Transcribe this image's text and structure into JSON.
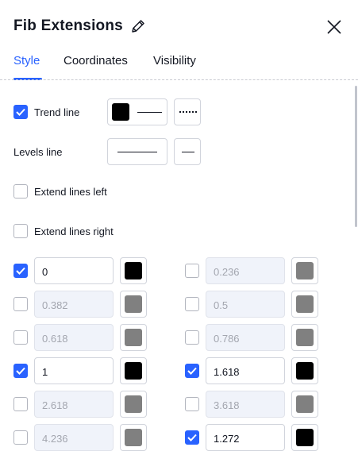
{
  "dialog": {
    "title": "Fib Extensions",
    "tabs": [
      {
        "label": "Style",
        "active": true
      },
      {
        "label": "Coordinates",
        "active": false
      },
      {
        "label": "Visibility",
        "active": false
      }
    ]
  },
  "style": {
    "trend_line": {
      "label": "Trend line",
      "checked": true,
      "color": "#000000",
      "line_style": "solid",
      "line_dash": "dotted"
    },
    "levels_line": {
      "label": "Levels line",
      "line_style": "solid"
    },
    "extend_left": {
      "label": "Extend lines left",
      "checked": false
    },
    "extend_right": {
      "label": "Extend lines right",
      "checked": false
    }
  },
  "levels": [
    {
      "value": "0",
      "checked": true,
      "color": "#000000"
    },
    {
      "value": "0.236",
      "checked": false,
      "color": "#808080"
    },
    {
      "value": "0.382",
      "checked": false,
      "color": "#808080"
    },
    {
      "value": "0.5",
      "checked": false,
      "color": "#808080"
    },
    {
      "value": "0.618",
      "checked": false,
      "color": "#808080"
    },
    {
      "value": "0.786",
      "checked": false,
      "color": "#808080"
    },
    {
      "value": "1",
      "checked": true,
      "color": "#000000"
    },
    {
      "value": "1.618",
      "checked": true,
      "color": "#000000"
    },
    {
      "value": "2.618",
      "checked": false,
      "color": "#808080"
    },
    {
      "value": "3.618",
      "checked": false,
      "color": "#808080"
    },
    {
      "value": "4.236",
      "checked": false,
      "color": "#808080"
    },
    {
      "value": "1.272",
      "checked": true,
      "color": "#000000"
    }
  ],
  "colors": {
    "accent": "#2962ff",
    "checked_swatch": "#000000",
    "unchecked_swatch": "#808080"
  },
  "icons": {
    "edit": "pencil-icon",
    "close": "close-icon",
    "check": "checkmark-icon"
  }
}
